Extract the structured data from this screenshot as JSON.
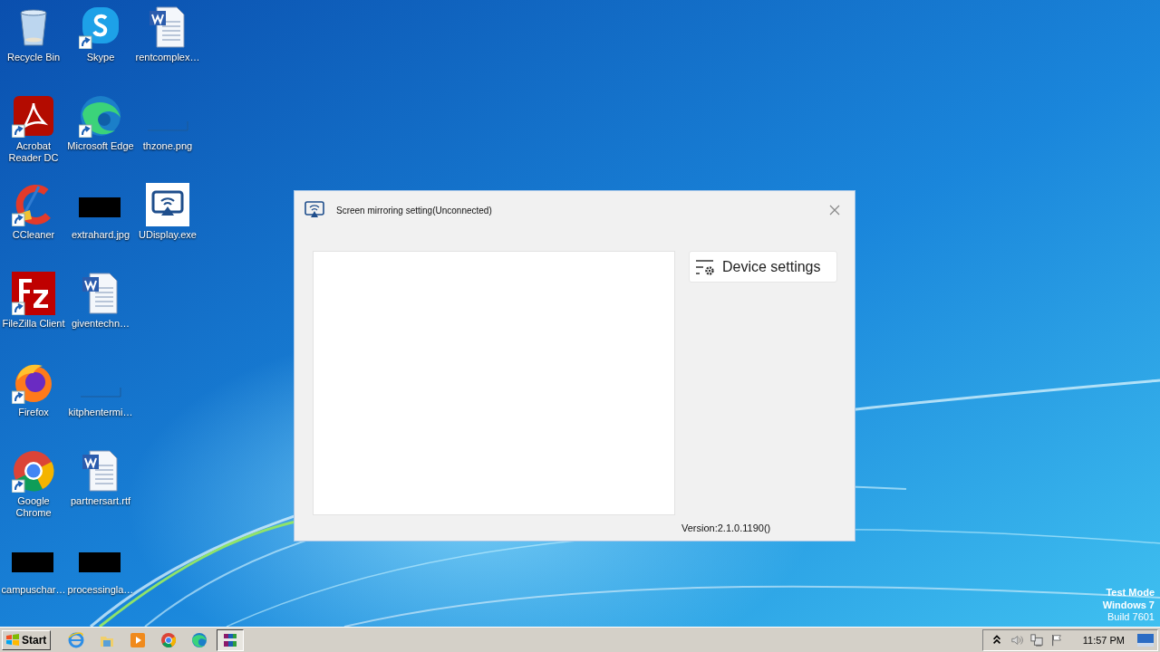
{
  "desktop_icons": [
    [
      {
        "label": "Recycle Bin",
        "kind": "recycle",
        "shortcut": false
      },
      {
        "label": "Skype",
        "kind": "skype",
        "shortcut": true
      },
      {
        "label": "rentcomplex…",
        "kind": "word",
        "shortcut": false
      }
    ],
    [
      {
        "label": "Acrobat Reader DC",
        "kind": "acrobat",
        "shortcut": true
      },
      {
        "label": "Microsoft Edge",
        "kind": "edge",
        "shortcut": true
      },
      {
        "label": "thzone.png",
        "kind": "thin",
        "shortcut": false
      }
    ],
    [
      {
        "label": "CCleaner",
        "kind": "ccleaner",
        "shortcut": true
      },
      {
        "label": "extrahard.jpg",
        "kind": "black",
        "shortcut": false
      },
      {
        "label": "UDisplay.exe",
        "kind": "udisplay",
        "shortcut": false
      }
    ],
    [
      {
        "label": "FileZilla Client",
        "kind": "filezilla",
        "shortcut": true
      },
      {
        "label": "giventechn…",
        "kind": "word",
        "shortcut": false
      }
    ],
    [
      {
        "label": "Firefox",
        "kind": "firefox",
        "shortcut": true
      },
      {
        "label": "kitphentermi…",
        "kind": "thin",
        "shortcut": false
      }
    ],
    [
      {
        "label": "Google Chrome",
        "kind": "chrome",
        "shortcut": true
      },
      {
        "label": "partnersart.rtf",
        "kind": "word",
        "shortcut": false
      }
    ],
    [
      {
        "label": "campuschar…",
        "kind": "black",
        "shortcut": false
      },
      {
        "label": "processingla…",
        "kind": "black",
        "shortcut": false
      }
    ]
  ],
  "window": {
    "title": "Screen mirroring setting(Unconnected)",
    "device_settings_button": "Device settings",
    "version": "Version:2.1.0.1190()"
  },
  "os_watermark": [
    "Test Mode",
    "Windows 7",
    "Build 7601"
  ],
  "taskbar": {
    "start": "Start",
    "pinned": [
      {
        "kind": "ie",
        "selected": false
      },
      {
        "kind": "explorer",
        "selected": false
      },
      {
        "kind": "media",
        "selected": false
      },
      {
        "kind": "chrome",
        "selected": false
      },
      {
        "kind": "edge",
        "selected": false
      },
      {
        "kind": "winrar",
        "selected": true
      }
    ],
    "clock": "11:57 PM"
  }
}
